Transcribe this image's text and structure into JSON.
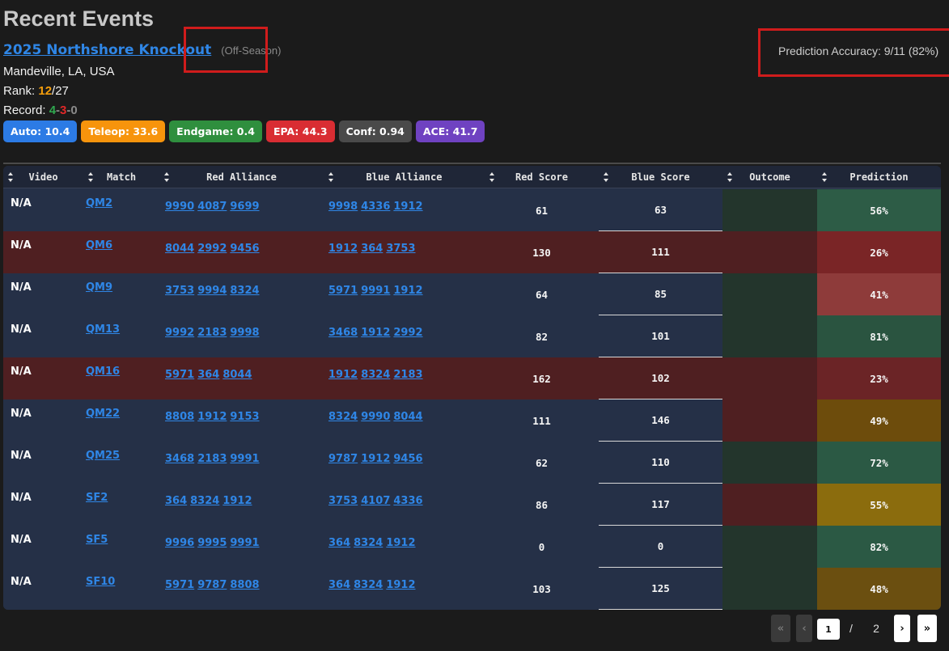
{
  "page": {
    "title": "Recent Events",
    "event_name": "2025 Northshore Knockout",
    "event_tag": "(Off-Season)",
    "location": "Mandeville, LA, USA",
    "rank_label": "Rank:",
    "rank": "12",
    "rank_total": "/27",
    "record_label": "Record:",
    "record_wins": "4",
    "record_losses": "3",
    "record_ties": "0",
    "accuracy": "Prediction Accuracy: 9/11 (82%)"
  },
  "badges": [
    {
      "label": "Auto: 10.4",
      "color": "#2c7be5"
    },
    {
      "label": "Teleop: 33.6",
      "color": "#f7940c"
    },
    {
      "label": "Endgame: 0.4",
      "color": "#2f8f3e"
    },
    {
      "label": "EPA: 44.3",
      "color": "#d92d33"
    },
    {
      "label": "Conf: 0.94",
      "color": "#4a4a4a"
    },
    {
      "label": "ACE: 41.7",
      "color": "#6f42c1"
    }
  ],
  "table": {
    "headers": [
      "Video",
      "Match",
      "Red Alliance",
      "Blue Alliance",
      "Red Score",
      "Blue Score",
      "Outcome",
      "Prediction"
    ],
    "rows": [
      {
        "video": "N/A",
        "match": "QM2",
        "red": [
          "9990",
          "4087",
          "9699"
        ],
        "blue": [
          "9998",
          "4336",
          "1912"
        ],
        "red_score": "61",
        "blue_score": "63",
        "prediction": "56%"
      },
      {
        "video": "N/A",
        "match": "QM6",
        "red": [
          "8044",
          "2992",
          "9456"
        ],
        "blue": [
          "1912",
          "364",
          "3753"
        ],
        "red_score": "130",
        "blue_score": "111",
        "prediction": "26%"
      },
      {
        "video": "N/A",
        "match": "QM9",
        "red": [
          "3753",
          "9994",
          "8324"
        ],
        "blue": [
          "5971",
          "9991",
          "1912"
        ],
        "red_score": "64",
        "blue_score": "85",
        "prediction": "41%"
      },
      {
        "video": "N/A",
        "match": "QM13",
        "red": [
          "9992",
          "2183",
          "9998"
        ],
        "blue": [
          "3468",
          "1912",
          "2992"
        ],
        "red_score": "82",
        "blue_score": "101",
        "prediction": "81%"
      },
      {
        "video": "N/A",
        "match": "QM16",
        "red": [
          "5971",
          "364",
          "8044"
        ],
        "blue": [
          "1912",
          "8324",
          "2183"
        ],
        "red_score": "162",
        "blue_score": "102",
        "prediction": "23%"
      },
      {
        "video": "N/A",
        "match": "QM22",
        "red": [
          "8808",
          "1912",
          "9153"
        ],
        "blue": [
          "8324",
          "9990",
          "8044"
        ],
        "red_score": "111",
        "blue_score": "146",
        "prediction": "49%"
      },
      {
        "video": "N/A",
        "match": "QM25",
        "red": [
          "3468",
          "2183",
          "9991"
        ],
        "blue": [
          "9787",
          "1912",
          "9456"
        ],
        "red_score": "62",
        "blue_score": "110",
        "prediction": "72%"
      },
      {
        "video": "N/A",
        "match": "SF2",
        "red": [
          "364",
          "8324",
          "1912"
        ],
        "blue": [
          "3753",
          "4107",
          "4336"
        ],
        "red_score": "86",
        "blue_score": "117",
        "prediction": "55%"
      },
      {
        "video": "N/A",
        "match": "SF5",
        "red": [
          "9996",
          "9995",
          "9991"
        ],
        "blue": [
          "364",
          "8324",
          "1912"
        ],
        "red_score": "0",
        "blue_score": "0",
        "prediction": "82%"
      },
      {
        "video": "N/A",
        "match": "SF10",
        "red": [
          "5971",
          "9787",
          "8808"
        ],
        "blue": [
          "364",
          "8324",
          "1912"
        ],
        "red_score": "103",
        "blue_score": "125",
        "prediction": "48%"
      }
    ]
  },
  "pagination": {
    "first_icon": "double-chevron-left-icon",
    "prev_icon": "chevron-left-icon",
    "current_page": "1",
    "separator": "/",
    "total_pages": "2",
    "next_icon": "chevron-right-icon",
    "last_icon": "double-chevron-right-icon"
  }
}
